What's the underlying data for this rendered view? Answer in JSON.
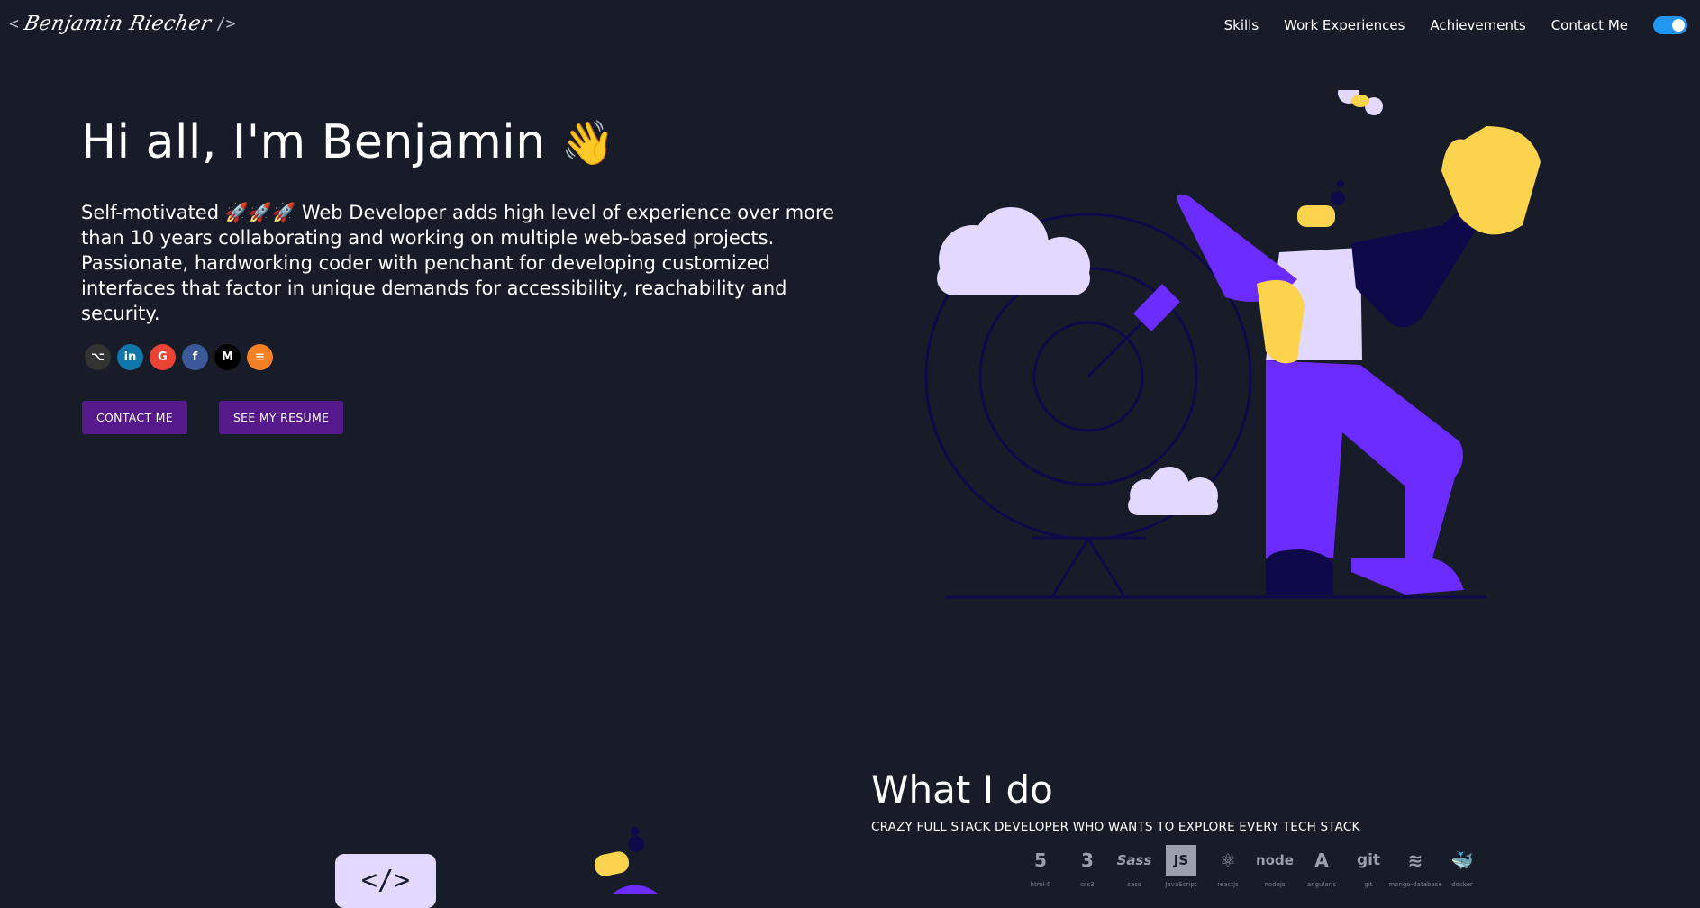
{
  "header": {
    "logo_open": "<",
    "logo_name": "Benjamin Riecher",
    "logo_close": "/>",
    "nav": [
      "Skills",
      "Work Experiences",
      "Achievements",
      "Contact Me"
    ],
    "theme_toggle_on": true
  },
  "hero": {
    "title": "Hi all, I'm Benjamin",
    "wave": "👋",
    "description": "Self-motivated 🚀🚀🚀 Web Developer adds high level of experience over more than 10 years collaborating and working on multiple web-based projects. Passionate, hardworking coder with penchant for developing customized interfaces that factor in unique demands for accessibility, reachability and security.",
    "socials": [
      {
        "name": "github",
        "glyph": "⌥",
        "color": "#333333"
      },
      {
        "name": "linkedin",
        "glyph": "in",
        "color": "#0e76a8"
      },
      {
        "name": "google",
        "glyph": "G",
        "color": "#ea4335"
      },
      {
        "name": "facebook",
        "glyph": "f",
        "color": "#3b5998"
      },
      {
        "name": "medium",
        "glyph": "M",
        "color": "#000000"
      },
      {
        "name": "stackoverflow",
        "glyph": "≡",
        "color": "#f48024"
      }
    ],
    "buttons": {
      "contact": "CONTACT ME",
      "resume": "SEE MY RESUME"
    }
  },
  "what_i_do": {
    "title": "What I do",
    "subtitle": "CRAZY FULL STACK DEVELOPER WHO WANTS TO EXPLORE EVERY TECH STACK",
    "skills": [
      {
        "name": "html-5",
        "glyph": "5"
      },
      {
        "name": "css3",
        "glyph": "3"
      },
      {
        "name": "sass",
        "glyph": "Sass"
      },
      {
        "name": "JavaScript",
        "glyph": "JS"
      },
      {
        "name": "reactjs",
        "glyph": "⚛"
      },
      {
        "name": "nodejs",
        "glyph": "node"
      },
      {
        "name": "angularjs",
        "glyph": "A"
      },
      {
        "name": "git",
        "glyph": "git"
      },
      {
        "name": "mongo-database",
        "glyph": "≋"
      },
      {
        "name": "docker",
        "glyph": "🐳"
      }
    ],
    "code_card": "</>"
  },
  "colors": {
    "background": "#171c28",
    "button": "#55198b",
    "toggle": "#2196f3",
    "illustration_purple": "#6c2bff",
    "illustration_lavender": "#e3d8ff",
    "illustration_yellow": "#fcd34d"
  }
}
